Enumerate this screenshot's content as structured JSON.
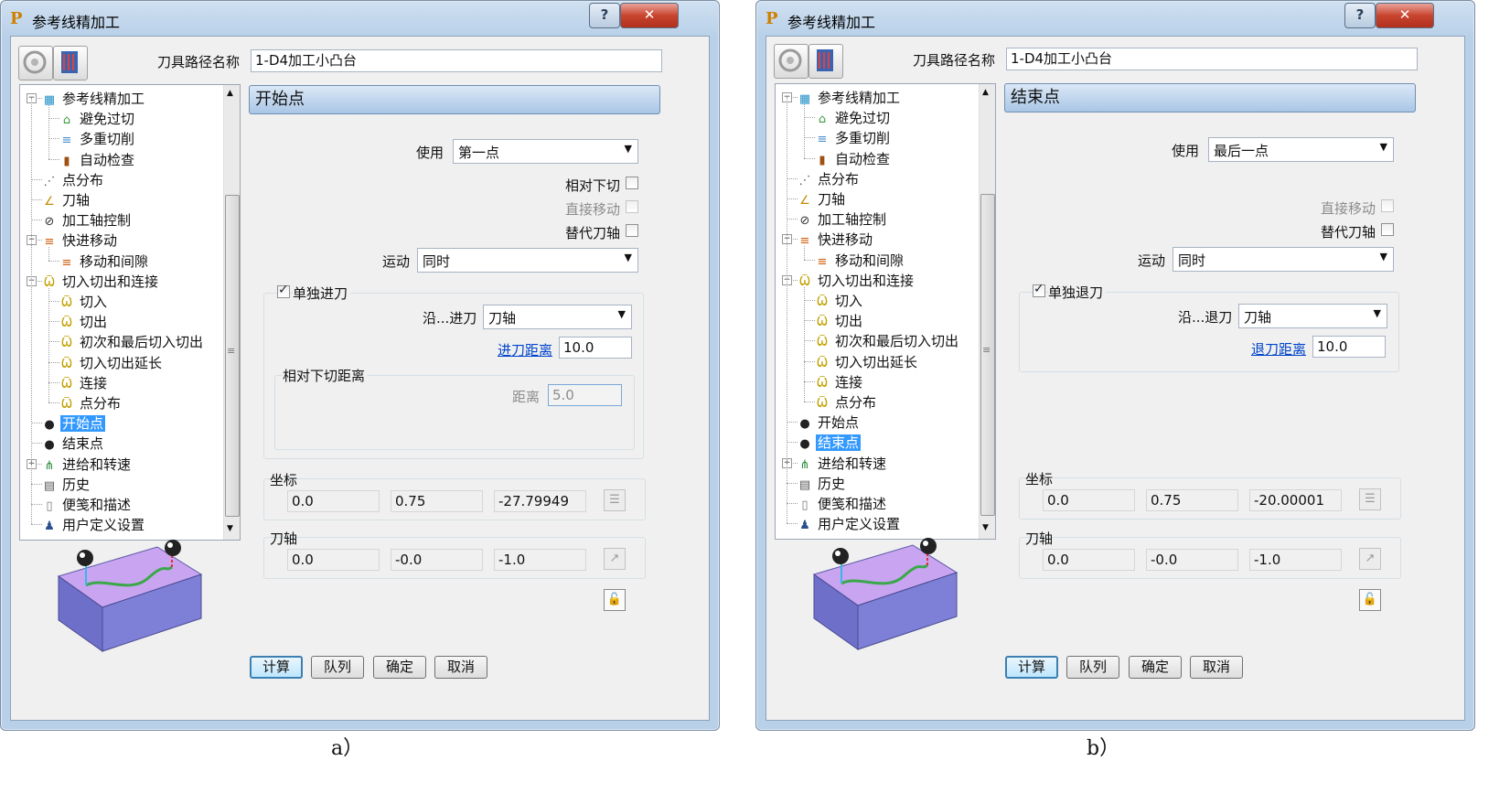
{
  "dialog_a": {
    "title": "参考线精加工",
    "help_label": "?",
    "close_label": "✕",
    "toolpath_name_label": "刀具路径名称",
    "toolpath_name_value": "1-D4加工小凸台",
    "tree": [
      {
        "label": "参考线精加工",
        "icon": "grid-icon"
      },
      {
        "label": "避免过切",
        "icon": "avoid-gouge-icon"
      },
      {
        "label": "多重切削",
        "icon": "multiple-cuts-icon"
      },
      {
        "label": "自动检查",
        "icon": "auto-verify-icon"
      },
      {
        "label": "点分布",
        "icon": "point-distribution-icon"
      },
      {
        "label": "刀轴",
        "icon": "tool-axis-icon"
      },
      {
        "label": "加工轴控制",
        "icon": "axis-control-icon"
      },
      {
        "label": "快进移动",
        "icon": "rapid-move-icon"
      },
      {
        "label": "移动和间隙",
        "icon": "move-clearance-icon"
      },
      {
        "label": "切入切出和连接",
        "icon": "leads-links-icon"
      },
      {
        "label": "切入",
        "icon": "lead-in-icon"
      },
      {
        "label": "切出",
        "icon": "lead-out-icon"
      },
      {
        "label": "初次和最后切入切出",
        "icon": "first-last-lead-icon"
      },
      {
        "label": "切入切出延长",
        "icon": "lead-extension-icon"
      },
      {
        "label": "连接",
        "icon": "links-icon"
      },
      {
        "label": "点分布",
        "icon": "leads-point-distribution-icon"
      },
      {
        "label": "开始点",
        "icon": "start-point-icon"
      },
      {
        "label": "结束点",
        "icon": "end-point-icon"
      },
      {
        "label": "进给和转速",
        "icon": "feeds-speeds-icon"
      },
      {
        "label": "历史",
        "icon": "history-icon"
      },
      {
        "label": "便笺和描述",
        "icon": "notes-icon"
      },
      {
        "label": "用户定义设置",
        "icon": "user-settings-icon"
      }
    ],
    "page_title": "开始点",
    "use_label": "使用",
    "use_value": "第一点",
    "relative_plunge_label": "相对下切",
    "direct_move_label": "直接移动",
    "substitute_axis_label": "替代刀轴",
    "motion_label": "运动",
    "motion_value": "同时",
    "separate_label": "单独进刀",
    "along_label": "沿...进刀",
    "along_value": "刀轴",
    "distance_link": "进刀距离",
    "distance_value": "10.0",
    "relative_group_label": "相对下切距离",
    "relative_distance_label": "距离",
    "relative_distance_value": "5.0",
    "coords_label": "坐标",
    "coords": [
      "0.0",
      "0.75",
      "-27.79949"
    ],
    "axis_label": "刀轴",
    "axis": [
      "0.0",
      "-0.0",
      "-1.0"
    ],
    "buttons": {
      "calc": "计算",
      "queue": "队列",
      "ok": "确定",
      "cancel": "取消"
    }
  },
  "dialog_b": {
    "title": "参考线精加工",
    "help_label": "?",
    "close_label": "✕",
    "toolpath_name_label": "刀具路径名称",
    "toolpath_name_value": "1-D4加工小凸台",
    "page_title": "结束点",
    "use_label": "使用",
    "use_value": "最后一点",
    "direct_move_label": "直接移动",
    "substitute_axis_label": "替代刀轴",
    "motion_label": "运动",
    "motion_value": "同时",
    "separate_label": "单独退刀",
    "along_label": "沿...退刀",
    "along_value": "刀轴",
    "distance_link": "退刀距离",
    "distance_value": "10.0",
    "coords_label": "坐标",
    "coords": [
      "0.0",
      "0.75",
      "-20.00001"
    ],
    "axis_label": "刀轴",
    "axis": [
      "0.0",
      "-0.0",
      "-1.0"
    ],
    "buttons": {
      "calc": "计算",
      "queue": "队列",
      "ok": "确定",
      "cancel": "取消"
    }
  },
  "captions": {
    "a": "a）",
    "b": "b）"
  },
  "colors": {
    "block_top": "#c9a4f0",
    "block_side": "#6d6fc9",
    "selection": "#3399ff",
    "path": "#3aa84a"
  }
}
